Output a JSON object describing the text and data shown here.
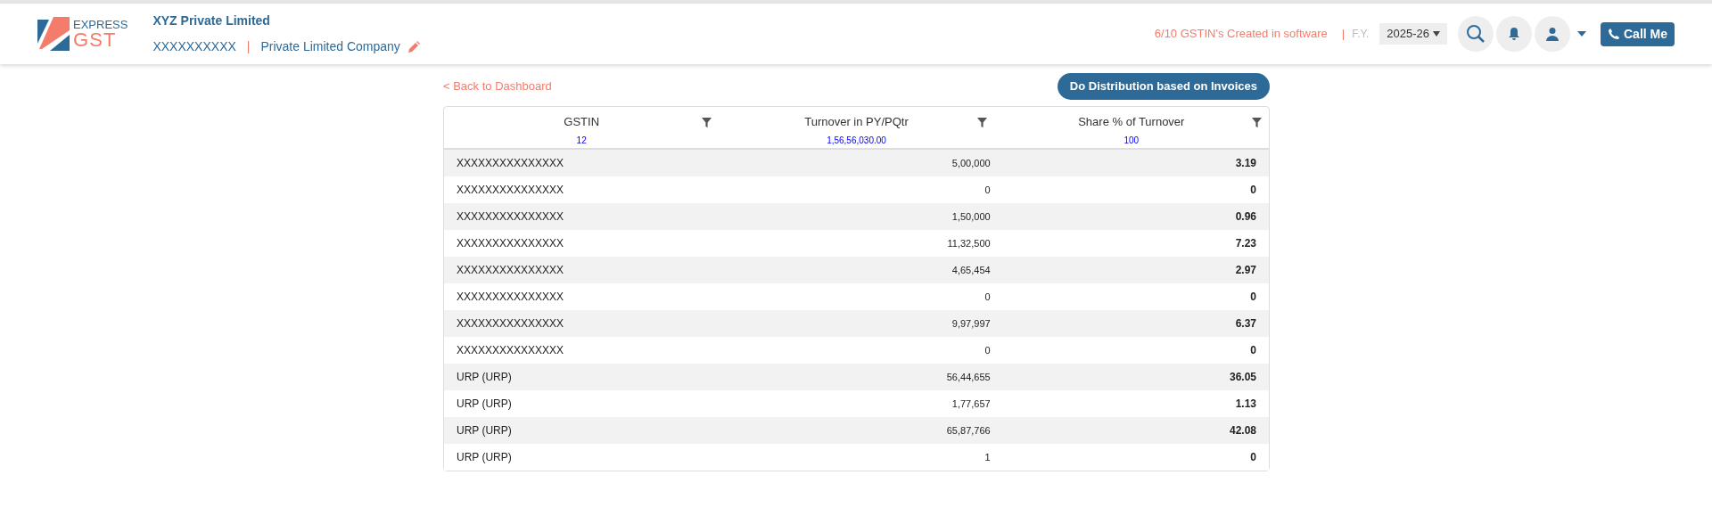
{
  "header": {
    "logo_top": "EXPRESS",
    "logo_bottom": "GST",
    "company": "XYZ Private Limited",
    "gstin": "XXXXXXXXXX",
    "separator": "|",
    "company_type": "Private Limited Company",
    "gstin_count": "6/10 GSTIN's Created in software",
    "separator_2": "|",
    "fy_label": "F.Y.",
    "fy_value": "2025-26",
    "call_button": "Call Me"
  },
  "back_link": "< Back to Dashboard",
  "distribute_button": "Do Distribution based on Invoices",
  "table": {
    "columns": [
      {
        "label": "GSTIN",
        "total": "12"
      },
      {
        "label": "Turnover in PY/PQtr",
        "total": "1,56,56,030.00"
      },
      {
        "label": "Share % of Turnover",
        "total": "100"
      }
    ],
    "rows": [
      [
        "XXXXXXXXXXXXXXX",
        "5,00,000",
        "3.19"
      ],
      [
        "XXXXXXXXXXXXXXX",
        "0",
        "0"
      ],
      [
        "XXXXXXXXXXXXXXX",
        "1,50,000",
        "0.96"
      ],
      [
        "XXXXXXXXXXXXXXX",
        "11,32,500",
        "7.23"
      ],
      [
        "XXXXXXXXXXXXXXX",
        "4,65,454",
        "2.97"
      ],
      [
        "XXXXXXXXXXXXXXX",
        "0",
        "0"
      ],
      [
        "XXXXXXXXXXXXXXX",
        "9,97,997",
        "6.37"
      ],
      [
        "XXXXXXXXXXXXXXX",
        "0",
        "0"
      ],
      [
        "URP (URP)",
        "56,44,655",
        "36.05"
      ],
      [
        "URP (URP)",
        "1,77,657",
        "1.13"
      ],
      [
        "URP (URP)",
        "65,87,766",
        "42.08"
      ],
      [
        "URP (URP)",
        "1",
        "0"
      ]
    ]
  }
}
